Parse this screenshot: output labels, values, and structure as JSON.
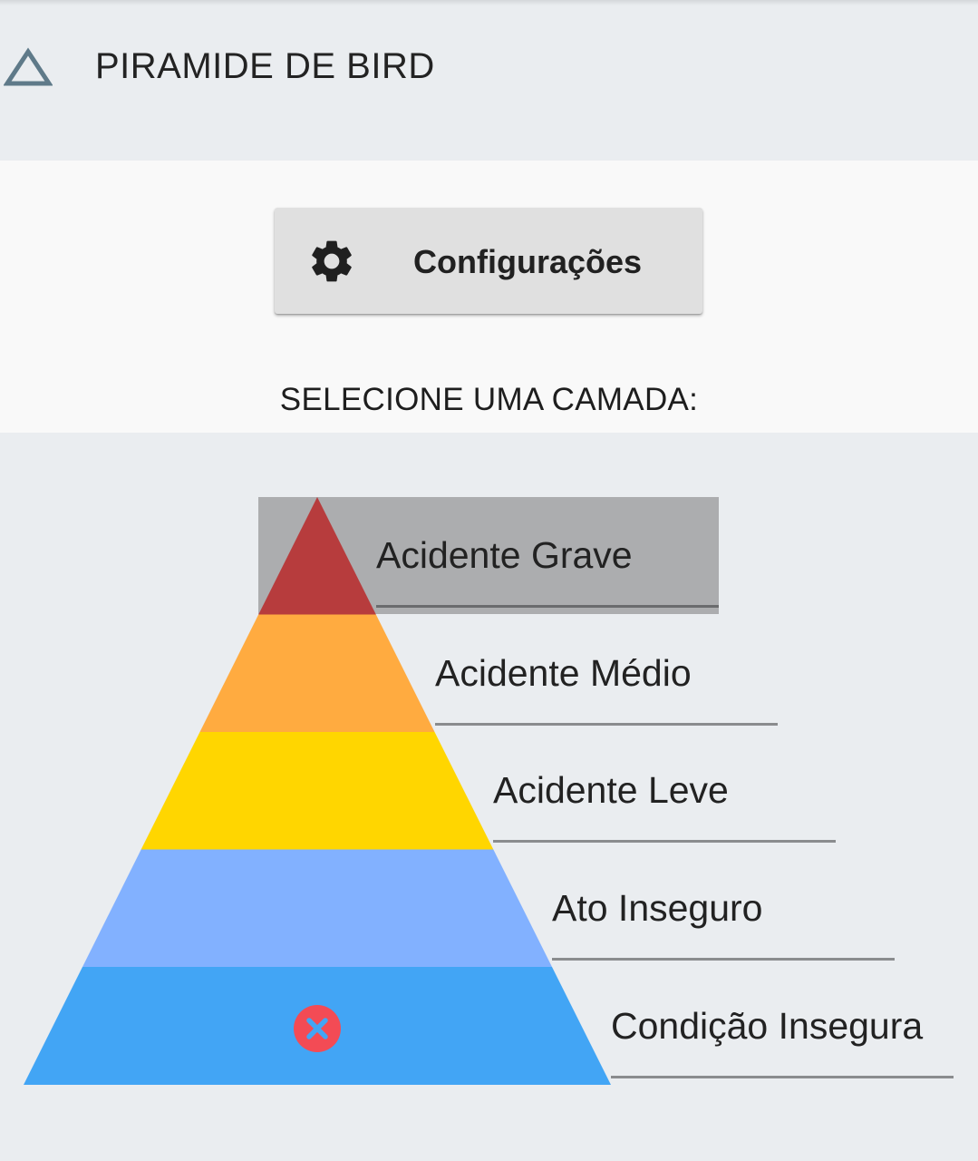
{
  "app": {
    "title": "PIRAMIDE DE BIRD",
    "logo_icon": "triangle-outline-icon"
  },
  "settings": {
    "label": "Configurações",
    "icon": "gear-icon"
  },
  "prompt": {
    "label": "SELECIONE UMA CAMADA:"
  },
  "pyramid": {
    "selected_layer": "Acidente Grave",
    "layers": [
      {
        "label": "Acidente Grave",
        "color": "#b73c3d"
      },
      {
        "label": "Acidente Médio",
        "color": "#ffab40"
      },
      {
        "label": "Acidente Leve",
        "color": "#ffd600"
      },
      {
        "label": "Ato Inseguro",
        "color": "#82b1ff"
      },
      {
        "label": "Condição Insegura",
        "color": "#42a5f5"
      }
    ],
    "clear_icon": "close-circle-icon",
    "clear_icon_color": "#f34b55"
  },
  "colors": {
    "background": "#eaedf0",
    "panel": "#f9f9f9",
    "selected_highlight": "#acadaf"
  }
}
